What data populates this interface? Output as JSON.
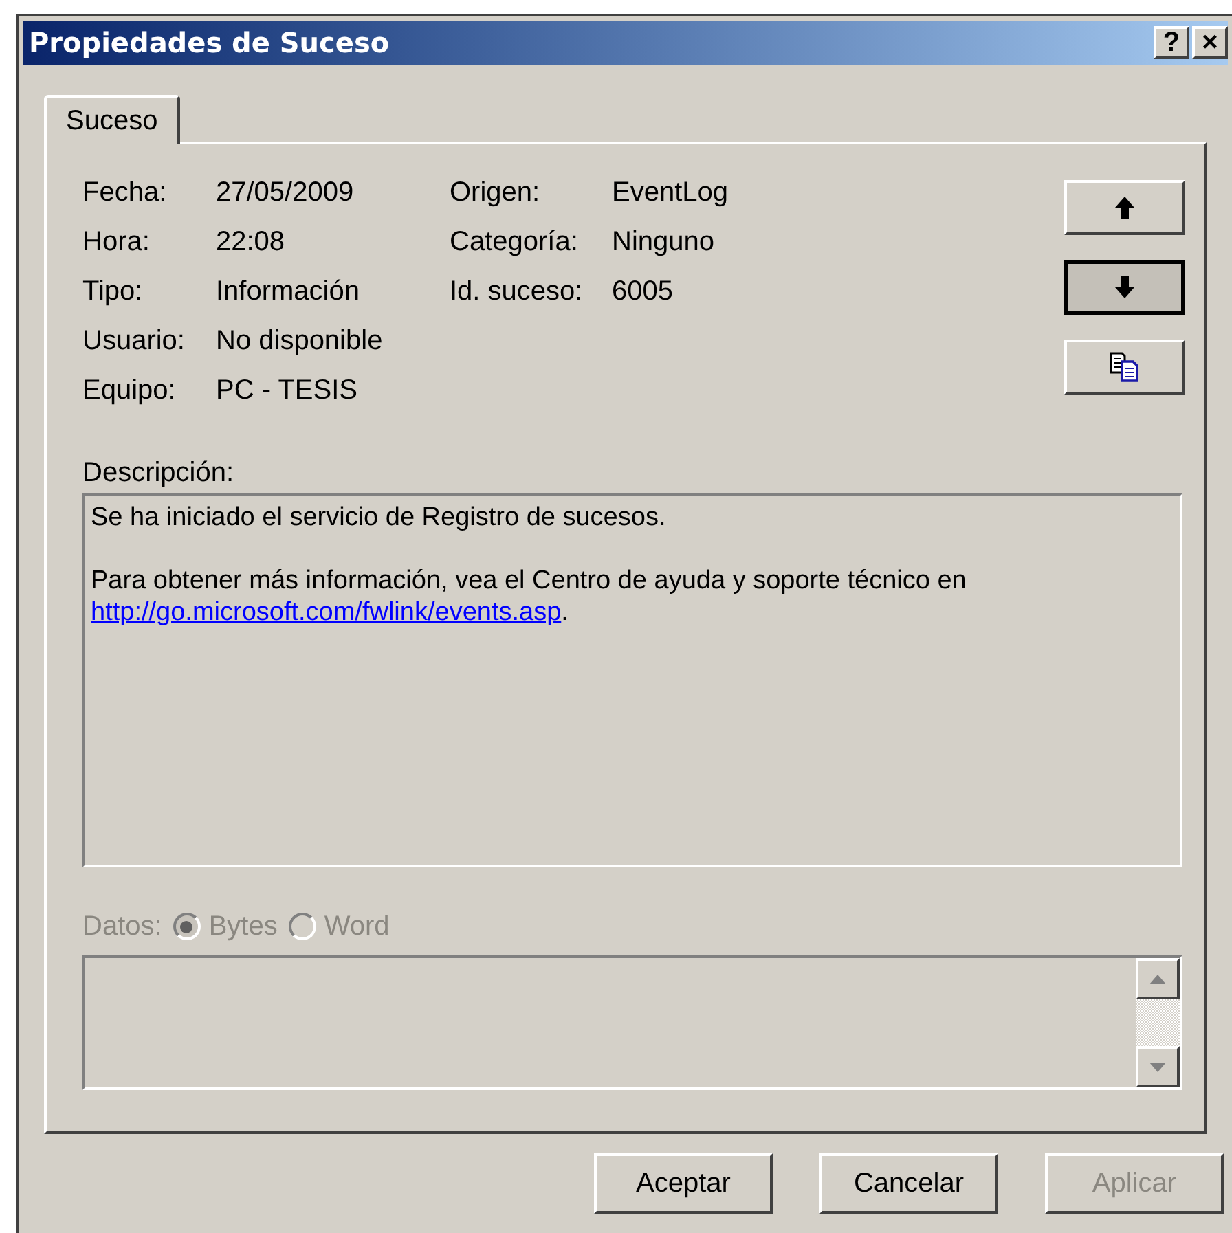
{
  "window": {
    "title": "Propiedades de Suceso",
    "controls": [
      "?",
      "×"
    ]
  },
  "tabs": [
    {
      "label": "Suceso",
      "selected": true
    }
  ],
  "fields_left": [
    {
      "label": "Fecha:",
      "value": "27/05/2009"
    },
    {
      "label": "Hora:",
      "value": "22:08"
    },
    {
      "label": "Tipo:",
      "value": "Información"
    },
    {
      "label": "Usuario:",
      "value": "No disponible"
    },
    {
      "label": "Equipo:",
      "value": "PC - TESIS"
    }
  ],
  "fields_right": [
    {
      "label": "Origen:",
      "value": "EventLog"
    },
    {
      "label": "Categoría:",
      "value": "Ninguno"
    },
    {
      "label": "Id. suceso:",
      "value": "6005"
    }
  ],
  "nav_buttons": [
    {
      "kind": "up",
      "focused": false
    },
    {
      "kind": "down",
      "focused": true
    },
    {
      "kind": "copy",
      "focused": false
    }
  ],
  "description": {
    "label": "Descripción:",
    "lines": [
      "Se ha iniciado el servicio de Registro de sucesos.",
      "Para obtener más información, vea el Centro de ayuda y soporte técnico en"
    ],
    "link": "http://go.microsoft.com/fwlink/events.asp",
    "link_suffix": "."
  },
  "data": {
    "label": "Datos:",
    "disabled": true,
    "options": [
      {
        "label": "Bytes",
        "selected": true
      },
      {
        "label": "Word",
        "selected": false
      }
    ]
  },
  "buttons": [
    {
      "label": "Aceptar",
      "disabled": false
    },
    {
      "label": "Cancelar",
      "disabled": false
    },
    {
      "label": "Aplicar",
      "disabled": true
    }
  ]
}
